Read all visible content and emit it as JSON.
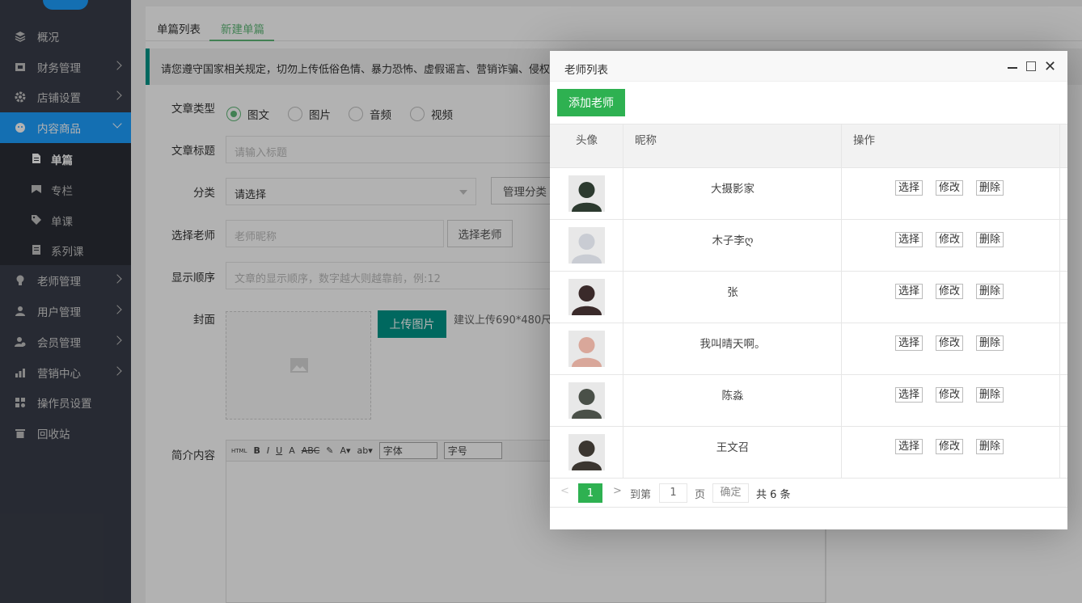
{
  "sidebar": {
    "items": [
      {
        "label": "概况",
        "icon": "layers-icon"
      },
      {
        "label": "财务管理",
        "icon": "finance-icon"
      },
      {
        "label": "店铺设置",
        "icon": "gear-icon"
      },
      {
        "label": "内容商品",
        "icon": "content-icon"
      },
      {
        "label": "老师管理",
        "icon": "bulb-icon"
      },
      {
        "label": "用户管理",
        "icon": "user-icon"
      },
      {
        "label": "会员管理",
        "icon": "member-icon"
      },
      {
        "label": "营销中心",
        "icon": "chart-icon"
      },
      {
        "label": "操作员设置",
        "icon": "operator-icon"
      },
      {
        "label": "回收站",
        "icon": "trash-icon"
      }
    ],
    "sub_items": [
      {
        "label": "单篇",
        "icon": "file-icon"
      },
      {
        "label": "专栏",
        "icon": "column-icon"
      },
      {
        "label": "单课",
        "icon": "tag-icon"
      },
      {
        "label": "系列课",
        "icon": "book-icon"
      }
    ]
  },
  "tabs": [
    "单篇列表",
    "新建单篇"
  ],
  "notice": "请您遵守国家相关规定，切勿上传低俗色情、暴力恐怖、虚假谣言、营销诈骗、侵权",
  "form": {
    "type_label": "文章类型",
    "types": [
      "图文",
      "图片",
      "音频",
      "视频"
    ],
    "title_label": "文章标题",
    "title_placeholder": "请输入标题",
    "category_label": "分类",
    "category_value": "请选择",
    "manage_category": "管理分类",
    "teacher_label": "选择老师",
    "teacher_placeholder": "老师昵称",
    "choose_teacher": "选择老师",
    "order_label": "显示顺序",
    "order_placeholder": "文章的显示顺序，数字越大则越靠前，例:12",
    "cover_label": "封面",
    "upload_label": "上传图片",
    "upload_hint": "建议上传690*480尺",
    "intro_label": "简介内容",
    "font_select": "字体",
    "size_select": "字号"
  },
  "dialog": {
    "title": "老师列表",
    "add_button": "添加老师",
    "columns": [
      "头像",
      "昵称",
      "操作"
    ],
    "rows": [
      {
        "nickname": "大摄影家",
        "avatar_color": "#2c3a2f"
      },
      {
        "nickname": "木子李ღ",
        "avatar_color": "#c9ccd3"
      },
      {
        "nickname": "张",
        "avatar_color": "#3a2a2a"
      },
      {
        "nickname": "我叫晴天啊。",
        "avatar_color": "#d9a79a"
      },
      {
        "nickname": "陈淼",
        "avatar_color": "#4a5048"
      },
      {
        "nickname": "王文召",
        "avatar_color": "#3b3630"
      }
    ],
    "actions": [
      "选择",
      "修改",
      "删除"
    ],
    "pager": {
      "current": "1",
      "goto": "到第",
      "page_input": "1",
      "page_unit": "页",
      "confirm": "确定",
      "total": "共 6 条"
    }
  },
  "colors": {
    "sidebar": "#393d49",
    "active": "#1e9fff",
    "green": "#2eb151",
    "teal": "#009688"
  }
}
